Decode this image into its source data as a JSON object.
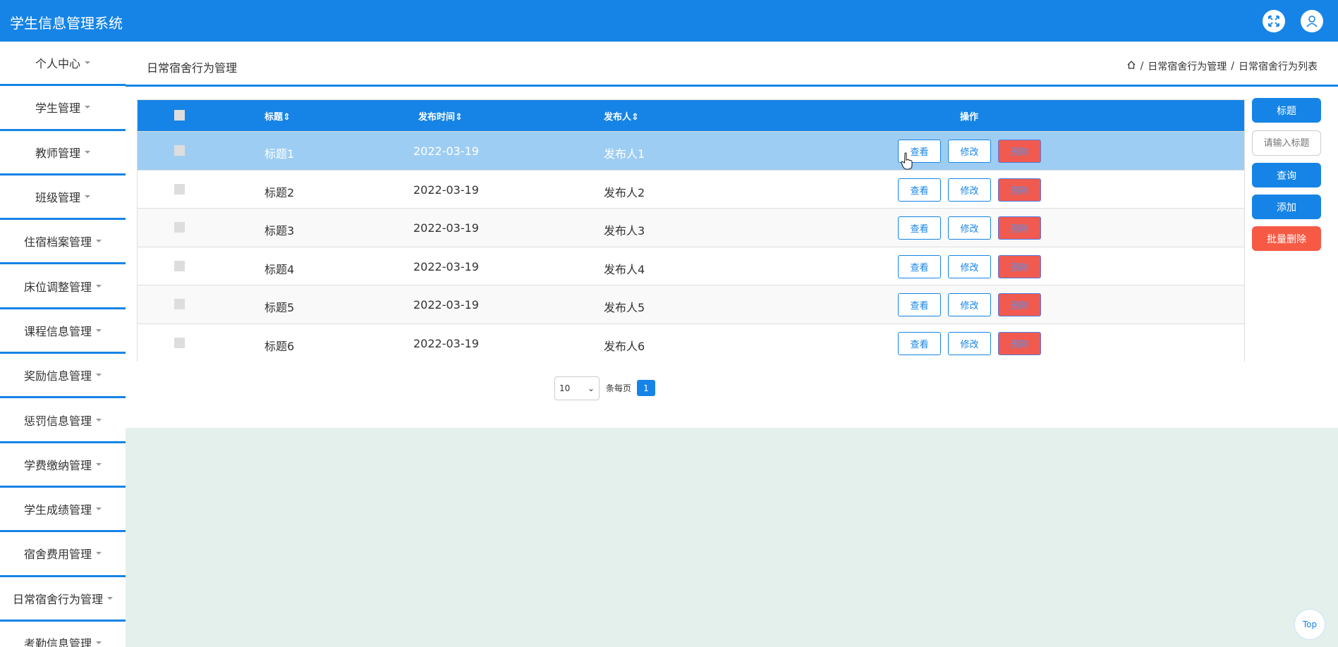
{
  "app": {
    "title": "学生信息管理系统"
  },
  "topbar": {
    "fullscreen_icon": "fullscreen-icon",
    "user_icon": "user-icon"
  },
  "sidebar": {
    "items": [
      {
        "label": "个人中心"
      },
      {
        "label": "学生管理"
      },
      {
        "label": "教师管理"
      },
      {
        "label": "班级管理"
      },
      {
        "label": "住宿档案管理"
      },
      {
        "label": "床位调整管理"
      },
      {
        "label": "课程信息管理"
      },
      {
        "label": "奖励信息管理"
      },
      {
        "label": "惩罚信息管理"
      },
      {
        "label": "学费缴纳管理"
      },
      {
        "label": "学生成绩管理"
      },
      {
        "label": "宿舍费用管理"
      },
      {
        "label": "日常宿舍行为管理"
      },
      {
        "label": "考勤信息管理"
      }
    ]
  },
  "header": {
    "page_title": "日常宿舍行为管理",
    "breadcrumb": [
      "日常宿舍行为管理",
      "日常宿舍行为列表"
    ]
  },
  "table": {
    "columns": [
      "标题",
      "发布时间",
      "发布人",
      "操作"
    ],
    "rows": [
      {
        "title": "标题1",
        "time": "2022-03-19",
        "publisher": "发布人1"
      },
      {
        "title": "标题2",
        "time": "2022-03-19",
        "publisher": "发布人2"
      },
      {
        "title": "标题3",
        "time": "2022-03-19",
        "publisher": "发布人3"
      },
      {
        "title": "标题4",
        "time": "2022-03-19",
        "publisher": "发布人4"
      },
      {
        "title": "标题5",
        "time": "2022-03-19",
        "publisher": "发布人5"
      },
      {
        "title": "标题6",
        "time": "2022-03-19",
        "publisher": "发布人6"
      }
    ],
    "actions": {
      "view": "查看",
      "edit": "修改",
      "delete": "删除"
    }
  },
  "search": {
    "field_label": "标题",
    "placeholder": "请输入标题",
    "query_label": "查询",
    "add_label": "添加",
    "batch_delete_label": "批量删除"
  },
  "pagination": {
    "page_size": "10",
    "per_page_label": "条每页",
    "current_page": "1"
  },
  "back_to_top": {
    "label": "Top"
  },
  "colors": {
    "primary": "#1684e6",
    "danger": "#f15a4f",
    "highlight_row": "#9ecdf3",
    "lower_bg": "#e3f0ec"
  }
}
